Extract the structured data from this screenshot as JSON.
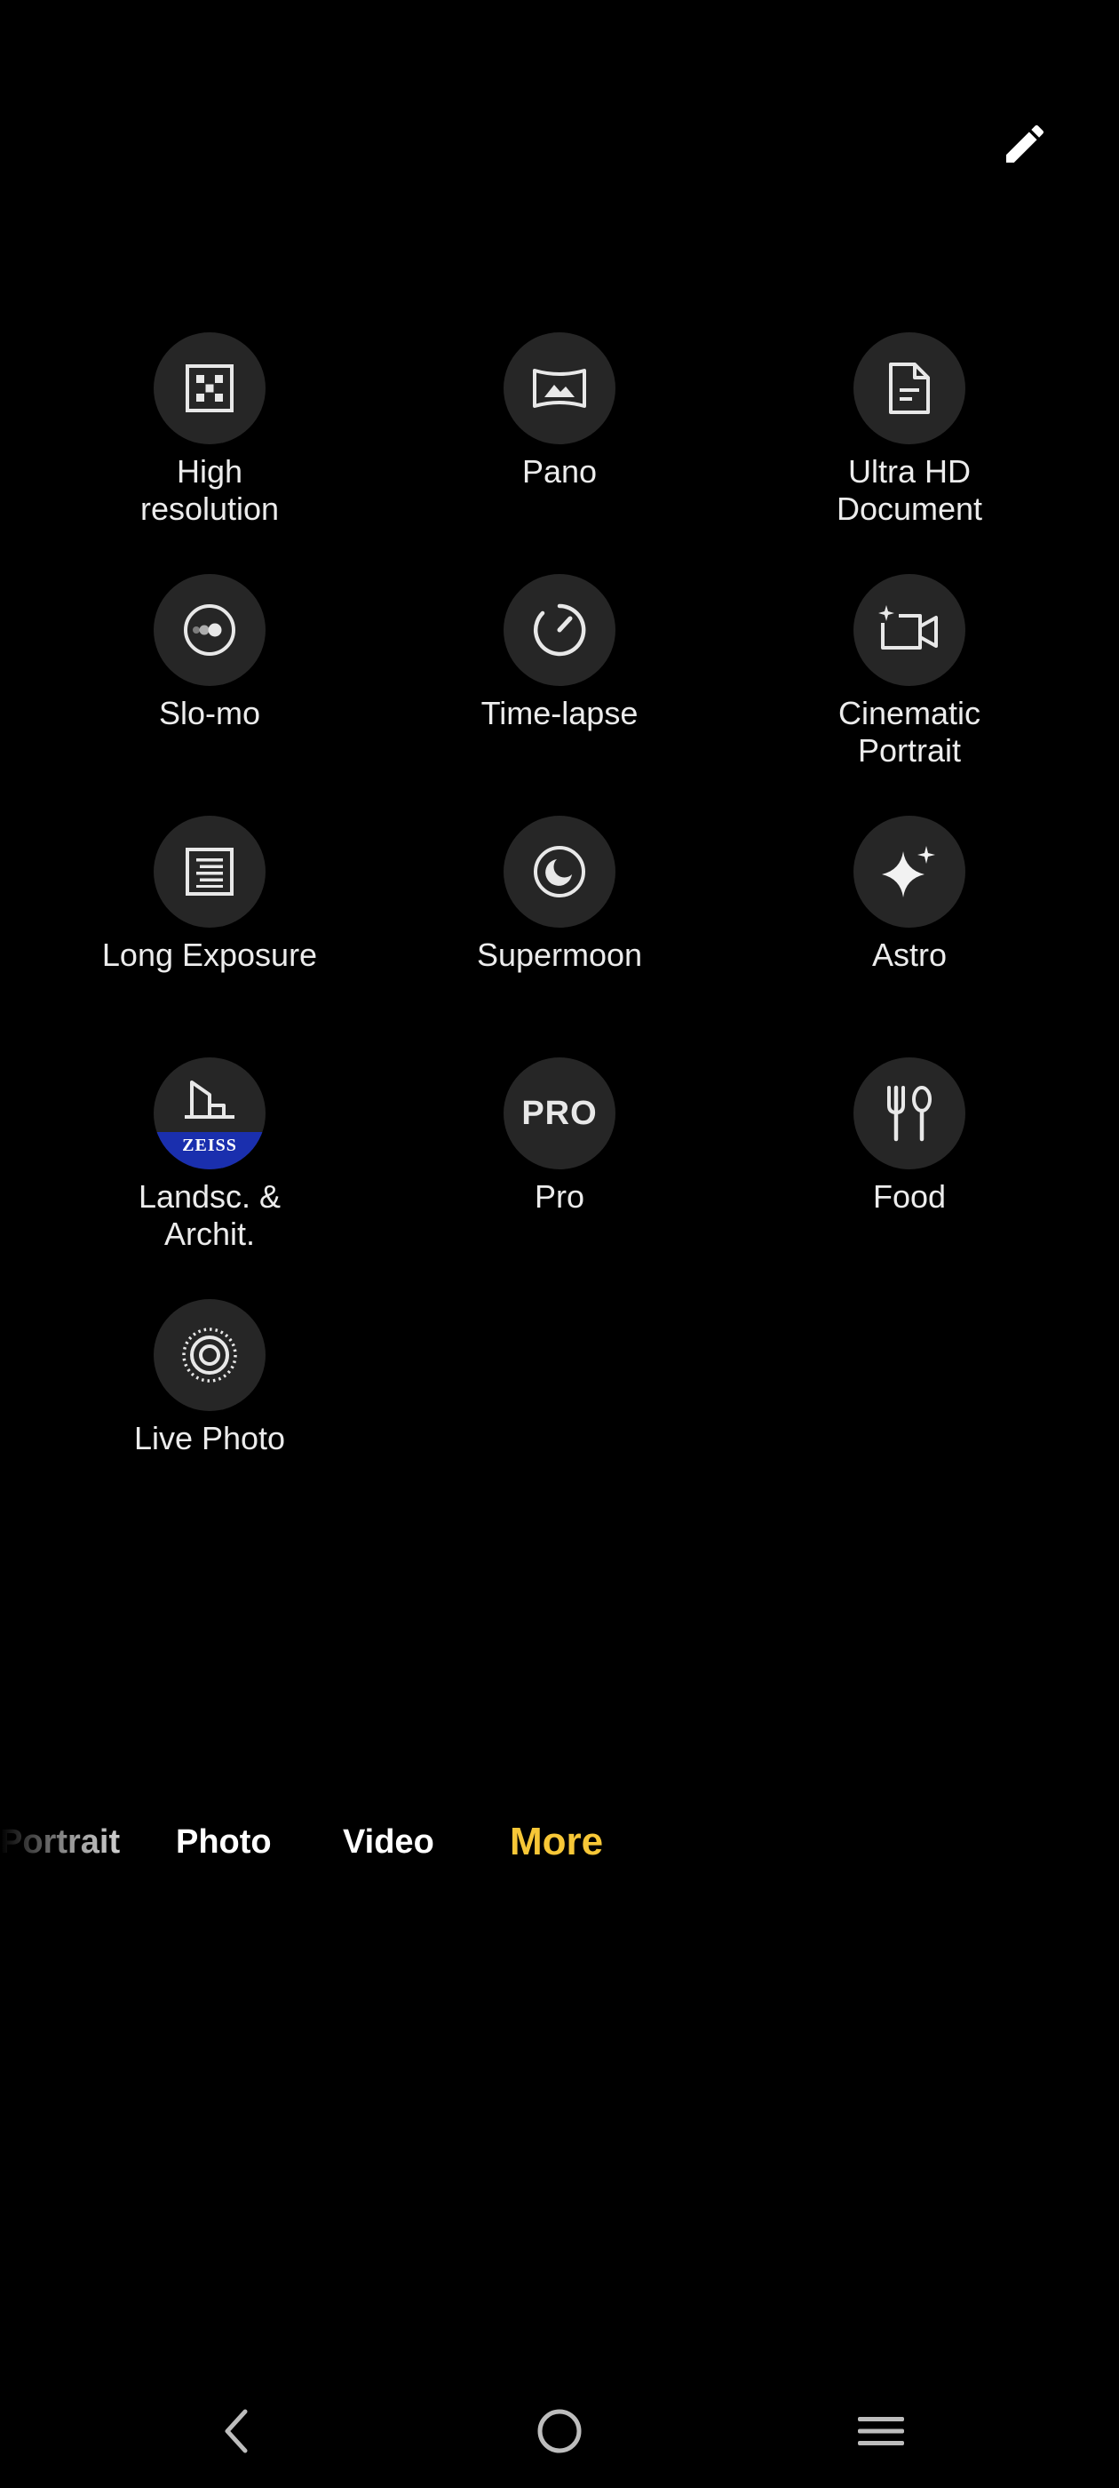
{
  "toolbar": {
    "edit_icon": "pencil-icon"
  },
  "modes": [
    {
      "label": "High\nresolution",
      "icon": "high-resolution-icon"
    },
    {
      "label": "Pano",
      "icon": "panorama-icon"
    },
    {
      "label": "Ultra HD\nDocument",
      "icon": "document-icon"
    },
    {
      "label": "Slo-mo",
      "icon": "slow-motion-icon"
    },
    {
      "label": "Time-lapse",
      "icon": "timer-icon"
    },
    {
      "label": "Cinematic\nPortrait",
      "icon": "video-camera-icon"
    },
    {
      "label": "Long Exposure",
      "icon": "long-exposure-icon"
    },
    {
      "label": "Supermoon",
      "icon": "moon-icon"
    },
    {
      "label": "Astro",
      "icon": "sparkle-icon"
    },
    {
      "label": "Landsc. &\nArchit.",
      "icon": "building-icon",
      "badge": "ZEISS"
    },
    {
      "label": "Pro",
      "icon": "pro-icon",
      "icon_text": "PRO"
    },
    {
      "label": "Food",
      "icon": "fork-spoon-icon"
    },
    {
      "label": "Live Photo",
      "icon": "live-photo-icon"
    }
  ],
  "mode_bar": {
    "tabs": [
      "Portrait",
      "Photo",
      "Video",
      "More"
    ],
    "active": "More",
    "active_color": "#f7c737"
  },
  "nav_bar": {
    "back_icon": "back-chevron-icon",
    "home_icon": "home-circle-icon",
    "menu_icon": "menu-icon"
  }
}
